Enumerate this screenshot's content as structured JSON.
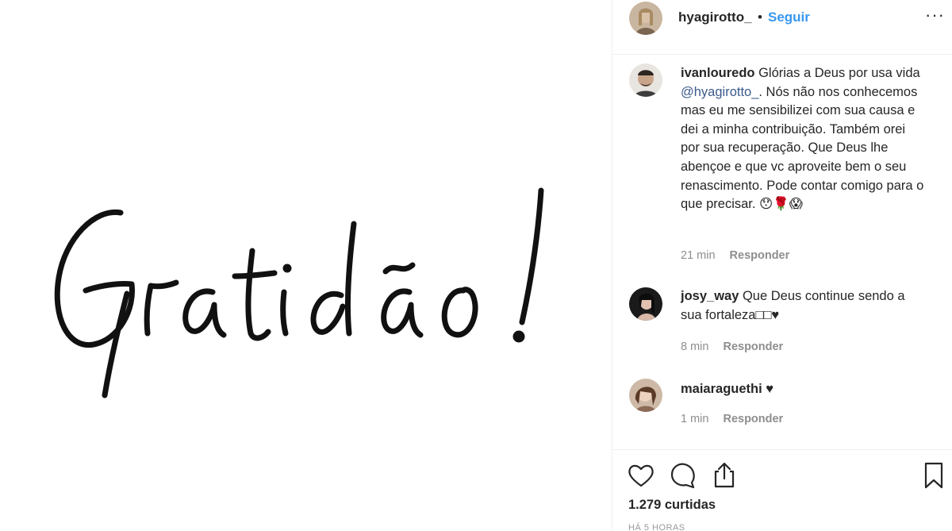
{
  "post": {
    "image_text": "Gratidão!",
    "author": {
      "username": "hyagirotto_",
      "separator": "•",
      "follow_label": "Seguir"
    },
    "more_icon": "more-options-icon",
    "more_label": "···"
  },
  "comments": [
    {
      "username": "ivanlouredo",
      "text_before": " Glórias a Deus por usa vida ",
      "mention": "@hyagirotto_",
      "text_after": ". Nós não nos conhecemos mas eu me sensibilizei com sua causa e dei a minha contribuição. Também orei por sua recuperação. Que Deus lhe abençoe e que vc aproveite bem o seu renascimento. Pode contar comigo para o que precisar. 😯🌹😱",
      "time": "21 min",
      "reply_label": "Responder"
    },
    {
      "username": "josy_way",
      "text": " Que Deus continue sendo a sua fortaleza□□♥",
      "time": "8 min",
      "reply_label": "Responder"
    },
    {
      "username": "maiaraguethi",
      "text": " ♥",
      "time": "1 min",
      "reply_label": "Responder"
    }
  ],
  "actions": {
    "like_icon": "heart-icon",
    "comment_icon": "comment-icon",
    "share_icon": "share-icon",
    "save_icon": "bookmark-icon"
  },
  "likes_count": "1.279 curtidas",
  "posted_ago": "HÁ 5 HORAS",
  "colors": {
    "link_blue": "#3897f0",
    "mention_blue": "#3b5a8c",
    "muted": "#8e8e8e",
    "border": "#efefef"
  }
}
